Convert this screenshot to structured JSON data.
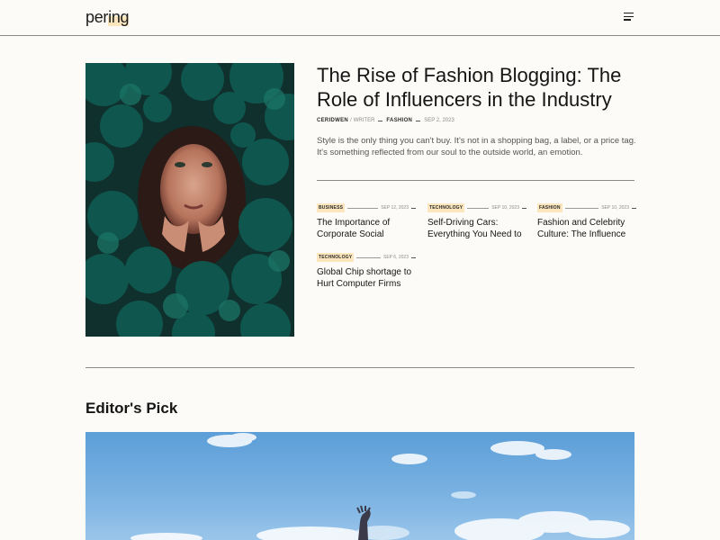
{
  "header": {
    "logo_pre": "per",
    "logo_hl": "ing",
    "menu_icon": "hamburger-menu-icon"
  },
  "featured": {
    "title": "The Rise of Fashion Blogging: The Role of Influencers in the Industry",
    "author": "CERIDWEN",
    "author_role": "WRITER",
    "category": "FASHION",
    "date": "SEP 2, 2023",
    "excerpt": "Style is the only thing you can't buy. It's not in a shopping bag, a label, or a price tag. It's something reflected from our soul to the outside world, an emotion."
  },
  "cards": [
    {
      "tag": "BUSINESS",
      "date": "SEP 12, 2023",
      "title": "The Importance of Corporate Social"
    },
    {
      "tag": "TECHNOLOGY",
      "date": "SEP 10, 2023",
      "title": "Self-Driving Cars: Everything You Need to"
    },
    {
      "tag": "FASHION",
      "date": "SEP 10, 2023",
      "title": "Fashion and Celebrity Culture: The Influence"
    },
    {
      "tag": "TECHNOLOGY",
      "date": "SEP 6, 2023",
      "title": "Global Chip shortage to Hurt Computer Firms"
    }
  ],
  "editors_pick": {
    "heading": "Editor's Pick"
  },
  "colors": {
    "background": "#fcfbf7",
    "tag_highlight": "#fbe6bd",
    "text": "#151515"
  }
}
